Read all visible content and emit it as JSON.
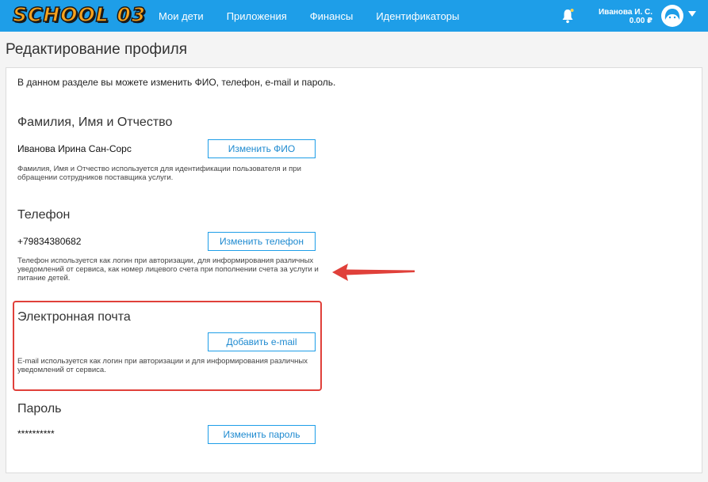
{
  "header": {
    "logo": "SCHOOL 03",
    "nav": [
      "Мои дети",
      "Приложения",
      "Финансы",
      "Идентификаторы"
    ],
    "user_name": "Иванова И. С.",
    "balance": "0.00 ₽",
    "icons": [
      "bell-icon",
      "avatar-icon",
      "caret-down-icon"
    ]
  },
  "page": {
    "title": "Редактирование профиля",
    "intro": "В данном разделе вы можете изменить ФИО, телефон, e-mail и пароль."
  },
  "sections": {
    "fio": {
      "title": "Фамилия, Имя и Отчество",
      "value": "Иванова Ирина Сан-Сорс",
      "button": "Изменить ФИО",
      "hint": "Фамилия, Имя и Отчество используется для идентификации пользователя и при обращении сотрудников поставщика услуги."
    },
    "phone": {
      "title": "Телефон",
      "value": "+79834380682",
      "button": "Изменить телефон",
      "hint": "Телефон используется как логин при авторизации, для информирования различных уведомлений от сервиса, как номер лицевого счета при пополнении счета за услуги и питание детей."
    },
    "email": {
      "title": "Электронная почта",
      "button": "Добавить e-mail",
      "hint": "E-mail используется как логин при авторизации и для информирования различных уведомлений от сервиса."
    },
    "password": {
      "title": "Пароль",
      "value": "**********",
      "button": "Изменить пароль"
    }
  },
  "annotation": {
    "highlight_color": "#e0403a"
  },
  "colors": {
    "brand": "#1e9ee8",
    "logo": "#f7a21c"
  }
}
